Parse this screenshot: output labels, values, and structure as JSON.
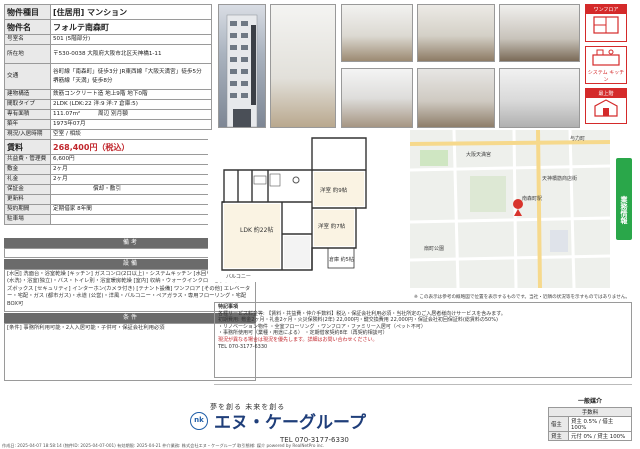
{
  "spec_rows": [
    {
      "k": "物件種目",
      "v": "[住居用] マンション"
    },
    {
      "k": "物件名",
      "v": "フォルテ南森町"
    },
    {
      "k": "号室名",
      "v": "501 (5階部分)"
    },
    {
      "k": "所在地",
      "v": "〒530-0038 大阪府大阪市北区天神橋1-11"
    },
    {
      "k": "交通",
      "v": "谷町線「南森町」徒歩3分 JR東西線「大阪天満宮」徒歩5分 堺筋線「天満」徒歩8分"
    },
    {
      "k": "建物構造",
      "v": "鉄筋コンクリート造 地上9階 地下0階"
    },
    {
      "k": "間取タイプ",
      "v": "2LDK (LDK:22 洋:9 洋:7 倉庫:5)"
    },
    {
      "k": "専有面積",
      "v": "111.07m²"
    },
    {
      "k": "築年",
      "v": "1973年07月"
    },
    {
      "k": "現況/入居時期",
      "v": "空室 / 相談"
    },
    {
      "k": "賃料",
      "v": "268,400円（税込）"
    },
    {
      "k": "共益費・管理費",
      "v": "6,600円"
    },
    {
      "k": "敷金",
      "v": "2ヶ月"
    },
    {
      "k": "礼金",
      "v": "2ヶ月"
    },
    {
      "k": "保証金",
      "v": ""
    },
    {
      "k": "更新料",
      "v": ""
    },
    {
      "k": "契約期間",
      "v": "定期借家 8年間"
    },
    {
      "k": "駐車場",
      "v": ""
    }
  ],
  "spec_extra": {
    "main_label": "",
    "extra1": "償却・敷引",
    "extra2": "周辺 別月額"
  },
  "sections": {
    "parking_title": "備 考",
    "equip_title": "設 備",
    "equip_text": "[水回] 洗面台・浴室乾燥 [キッチン] ガスコンロ(2口以上)・システムキッチン [水回り] 洗面・トイレ(水洗)・浴室(独立)・バス・トイレ別・浴室暖房乾燥 [室内] 収納・ウォークインクローゼット・シューズボックス [セキュリティ] インターホン(カメラ付き) [テナント設備] ワンフロア [その他] エレベーター・宅配・ガス (都市ガス)・水道 (公営)・洋風・バルコニー・ペアガラス・専用フローリング・宅配BOX可",
    "conditions_title": "条 件",
    "conditions_text": "[条件] 事務所利用可能・2人入居可能・子供可・保証会社利用必須"
  },
  "badges": [
    "ワンフロア",
    "システム キッチン",
    "最上階"
  ],
  "plan_labels": [
    "LDK 約22帖",
    "洋室 約9帖",
    "洋室 約7帖",
    "倉庫 約5帖",
    "バルコニー"
  ],
  "map": {
    "labels": [
      "大阪天満宮",
      "南森町駅",
      "天神橋筋商店街",
      "扇町公園",
      "与力町"
    ],
    "note": "※ この表示は参考の概略図で位置を表示するものです。当社・近隣の状況等を示すものではありません。"
  },
  "side_tab": "業務情報",
  "remarks": {
    "title": "特記事項",
    "lines": [
      "各種サービス料金等: 【賃料・共益費・仲介手数料】税込・保証会社利用必須・当社所定のご入居者様向けサービスを含みます。",
      "初期費用: 敷金2ヶ月・礼金2ヶ月・火災保険料(2年) 22,000円・鍵交換費用 22,000円・保証会社初回保証料(総賃料の50%)",
      "・リノベーション物件 ・全室フローリング ・ワンフロア・ファミリー入居可（ペット不可）",
      "・事務所使用可（業種・用途による） ・定期借家契約8年（再契約相談可）",
      "現況が異なる場合は現況を優先します。詳細はお問い合わせください。"
    ],
    "tel_line": "TEL 070-3177-6330"
  },
  "footer": {
    "slogan": "夢を創る 未来を創る",
    "logo": "エヌ・ケーグループ",
    "tel_label": "TEL 070-3177-6330",
    "right_title": "一般媒介",
    "right_rows": [
      [
        "手数料",
        ""
      ],
      [
        "借主",
        "貸主 0.5% / 借主 100%"
      ],
      [
        "貸主",
        "元付 0% / 貸主 100%"
      ]
    ],
    "strip": "作成日: 2025-04-07 18:58:14 (物件ID: 2025-04-07-001) 有効期限: 2025-04-21 仲介業務: 株式会社エヌ・ケーグループ 取引態様: 媒介 powered by RealNetPro inc."
  },
  "colors": {
    "price": "#c1272d",
    "accent_green": "#2aa74a",
    "logo_blue": "#1f3e7a",
    "badge_red": "#d42a2a"
  }
}
